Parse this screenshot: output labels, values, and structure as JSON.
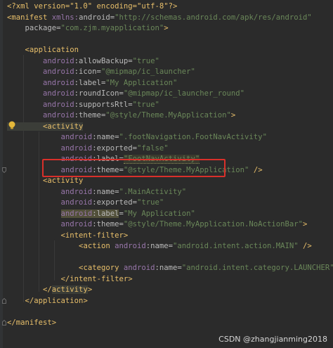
{
  "code_lines": [
    {
      "parts": [
        {
          "c": "prolog",
          "t": "<?xml version=\"1.0\" encoding=\"utf-8\"?>"
        }
      ]
    },
    {
      "parts": [
        {
          "c": "bracket",
          "t": "<"
        },
        {
          "c": "tag",
          "t": "manifest "
        },
        {
          "c": "ns",
          "t": "xmlns:"
        },
        {
          "c": "attr",
          "t": "android="
        },
        {
          "c": "val",
          "t": "\"http://schemas.android.com/apk/res/android\""
        }
      ]
    },
    {
      "parts": [
        {
          "c": "attr",
          "t": "    package="
        },
        {
          "c": "val",
          "t": "\"com.zjm.myapplication\""
        },
        {
          "c": "bracket",
          "t": ">"
        }
      ]
    },
    {
      "parts": []
    },
    {
      "parts": [
        {
          "c": "bracket",
          "t": "    <"
        },
        {
          "c": "tag",
          "t": "application"
        }
      ]
    },
    {
      "parts": [
        {
          "c": "ns",
          "t": "        android"
        },
        {
          "c": "attr",
          "t": ":allowBackup="
        },
        {
          "c": "val",
          "t": "\"true\""
        }
      ]
    },
    {
      "parts": [
        {
          "c": "ns",
          "t": "        android"
        },
        {
          "c": "attr",
          "t": ":icon="
        },
        {
          "c": "val",
          "t": "\"@mipmap/ic_launcher\""
        }
      ]
    },
    {
      "parts": [
        {
          "c": "ns",
          "t": "        android"
        },
        {
          "c": "attr",
          "t": ":label="
        },
        {
          "c": "val",
          "t": "\"My Application\""
        }
      ]
    },
    {
      "parts": [
        {
          "c": "ns",
          "t": "        android"
        },
        {
          "c": "attr",
          "t": ":roundIcon="
        },
        {
          "c": "val",
          "t": "\"@mipmap/ic_launcher_round\""
        }
      ]
    },
    {
      "parts": [
        {
          "c": "ns",
          "t": "        android"
        },
        {
          "c": "attr",
          "t": ":supportsRtl="
        },
        {
          "c": "val",
          "t": "\"true\""
        }
      ]
    },
    {
      "parts": [
        {
          "c": "ns",
          "t": "        android"
        },
        {
          "c": "attr",
          "t": ":theme="
        },
        {
          "c": "val",
          "t": "\"@style/Theme.MyApplication\""
        },
        {
          "c": "bracket",
          "t": ">"
        }
      ]
    },
    {
      "parts": [
        {
          "c": "bracket hl-tag",
          "t": "        <"
        },
        {
          "c": "tag hl-tag",
          "t": "activity"
        }
      ]
    },
    {
      "parts": [
        {
          "c": "ns",
          "t": "            android"
        },
        {
          "c": "attr",
          "t": ":name="
        },
        {
          "c": "val",
          "t": "\".footNavigation.FootNavActivity\""
        }
      ]
    },
    {
      "parts": [
        {
          "c": "ns",
          "t": "            android"
        },
        {
          "c": "attr",
          "t": ":exported="
        },
        {
          "c": "val",
          "t": "\"false\""
        }
      ]
    },
    {
      "parts": [
        {
          "c": "ns",
          "t": "            android"
        },
        {
          "c": "attr",
          "t": ":label="
        },
        {
          "c": "val hl-squiggle",
          "t": "\"FootNavActivity\""
        }
      ]
    },
    {
      "parts": [
        {
          "c": "ns",
          "t": "            android"
        },
        {
          "c": "attr",
          "t": ":theme="
        },
        {
          "c": "val",
          "t": "\"@style/Theme.MyApplication\""
        },
        {
          "c": "bracket",
          "t": " />"
        }
      ]
    },
    {
      "parts": [
        {
          "c": "bracket",
          "t": "        <"
        },
        {
          "c": "tag",
          "t": "activity"
        }
      ]
    },
    {
      "parts": [
        {
          "c": "ns",
          "t": "            android"
        },
        {
          "c": "attr",
          "t": ":name="
        },
        {
          "c": "val",
          "t": "\".MainActivity\""
        }
      ]
    },
    {
      "parts": [
        {
          "c": "ns",
          "t": "            android"
        },
        {
          "c": "attr",
          "t": ":exported="
        },
        {
          "c": "val",
          "t": "\"true\""
        }
      ]
    },
    {
      "parts": [
        {
          "c": "attr",
          "t": "            "
        },
        {
          "c": "ns hl-attr",
          "t": "android"
        },
        {
          "c": "attr hl-attr",
          "t": ":label"
        },
        {
          "c": "attr",
          "t": "="
        },
        {
          "c": "val",
          "t": "\"My Application\""
        }
      ]
    },
    {
      "parts": [
        {
          "c": "ns",
          "t": "            android"
        },
        {
          "c": "attr",
          "t": ":theme="
        },
        {
          "c": "val",
          "t": "\"@style/Theme.MyApplication.NoActionBar\""
        },
        {
          "c": "bracket",
          "t": ">"
        }
      ]
    },
    {
      "parts": [
        {
          "c": "bracket",
          "t": "            <"
        },
        {
          "c": "tag",
          "t": "intent-filter"
        },
        {
          "c": "bracket",
          "t": ">"
        }
      ]
    },
    {
      "parts": [
        {
          "c": "bracket",
          "t": "                <"
        },
        {
          "c": "tag",
          "t": "action "
        },
        {
          "c": "ns",
          "t": "android"
        },
        {
          "c": "attr",
          "t": ":name="
        },
        {
          "c": "val",
          "t": "\"android.intent.action.MAIN\""
        },
        {
          "c": "bracket",
          "t": " />"
        }
      ]
    },
    {
      "parts": []
    },
    {
      "parts": [
        {
          "c": "bracket",
          "t": "                <"
        },
        {
          "c": "tag",
          "t": "category "
        },
        {
          "c": "ns",
          "t": "android"
        },
        {
          "c": "attr",
          "t": ":name="
        },
        {
          "c": "val",
          "t": "\"android.intent.category.LAUNCHER\""
        },
        {
          "c": "bracket",
          "t": " />"
        }
      ]
    },
    {
      "parts": [
        {
          "c": "bracket",
          "t": "            </"
        },
        {
          "c": "tag",
          "t": "intent-filter"
        },
        {
          "c": "bracket",
          "t": ">"
        }
      ]
    },
    {
      "parts": [
        {
          "c": "bracket",
          "t": "        </"
        },
        {
          "c": "tag hl-tag",
          "t": "activity"
        },
        {
          "c": "bracket",
          "t": ">"
        }
      ]
    },
    {
      "parts": [
        {
          "c": "bracket",
          "t": "    </"
        },
        {
          "c": "tag",
          "t": "application"
        },
        {
          "c": "bracket",
          "t": ">"
        }
      ]
    },
    {
      "parts": []
    },
    {
      "parts": [
        {
          "c": "bracket",
          "t": "</"
        },
        {
          "c": "tag",
          "t": "manifest"
        },
        {
          "c": "bracket",
          "t": ">"
        }
      ]
    }
  ],
  "watermark": "CSDN @zhangjianming2018",
  "colors": {
    "background": "#2b2b2b",
    "tag": "#e8bf6a",
    "namespace": "#9876aa",
    "attribute": "#bababa",
    "value": "#6a8759",
    "highlight_box": "#d9302a"
  }
}
